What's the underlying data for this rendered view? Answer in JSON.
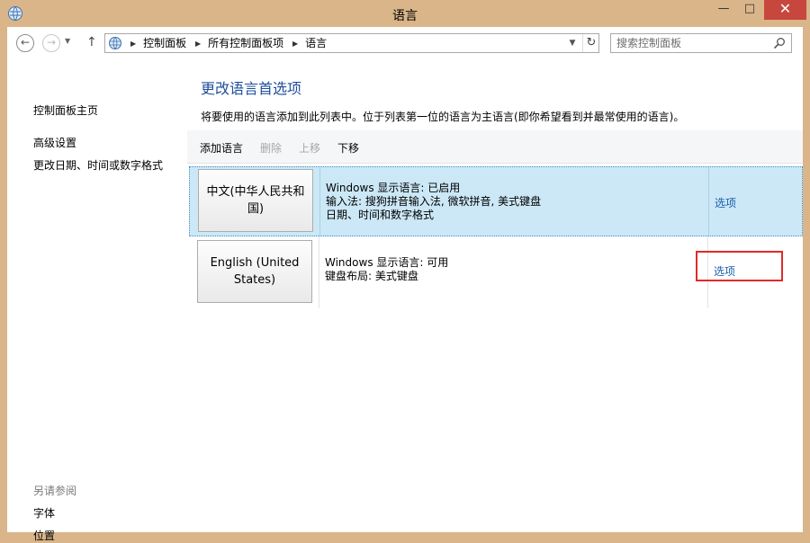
{
  "window": {
    "title": "语言",
    "minimize_label": "—",
    "maximize_label": "□",
    "close_label": "✕",
    "close_color": "#c7473e",
    "frame_color": "#d9b589"
  },
  "address_bar": {
    "breadcrumbs": [
      "控制面板",
      "所有控制面板项",
      "语言"
    ],
    "search_placeholder": "搜索控制面板"
  },
  "sidebar": {
    "home_link": "控制面板主页",
    "links": [
      "高级设置",
      "更改日期、时间或数字格式"
    ],
    "see_also_heading": "另请参阅",
    "see_also_links": [
      "字体",
      "位置"
    ]
  },
  "main": {
    "title": "更改语言首选项",
    "description": "将要使用的语言添加到此列表中。位于列表第一位的语言为主语言(即你希望看到并最常使用的语言)。",
    "toolbar": {
      "add": "添加语言",
      "remove": "删除",
      "move_up": "上移",
      "move_down": "下移"
    },
    "languages": [
      {
        "name": "中文(中华人民共和国)",
        "details": [
          "Windows 显示语言: 已启用",
          "输入法: 搜狗拼音输入法, 微软拼音, 美式键盘",
          "日期、时间和数字格式"
        ],
        "options_label": "选项",
        "selected": true
      },
      {
        "name": "English (United States)",
        "details": [
          "Windows 显示语言: 可用",
          "键盘布局: 美式键盘"
        ],
        "options_label": "选项",
        "selected": false
      }
    ]
  },
  "colors": {
    "title_blue": "#1e4e9a",
    "link_blue": "#1a5ea8",
    "selected_row": "#cce8f7",
    "highlight_red": "#e02a2a"
  }
}
